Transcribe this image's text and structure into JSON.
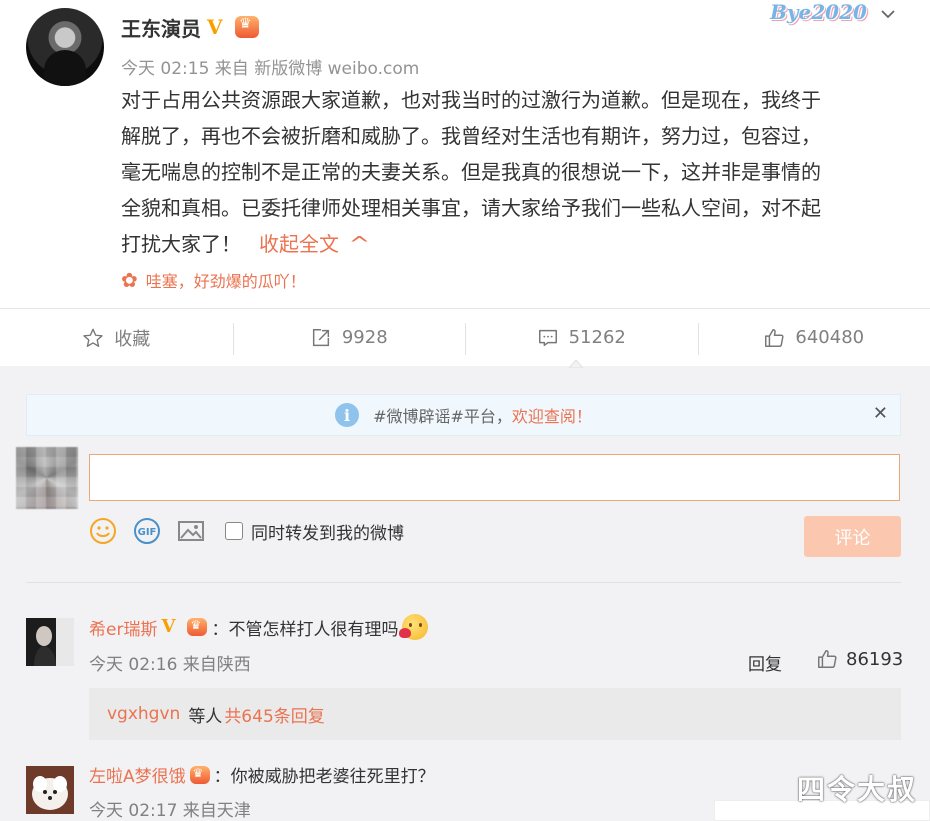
{
  "post": {
    "author": "王东演员",
    "verified_mark": "V",
    "meta": "今天 02:15 来自 新版微博 weibo.com",
    "text_lines": [
      "对于占用公共资源跟大家道歉，也对我当时的过激行为道歉。但是现在，我终于",
      "解脱了，再也不会被折磨和威胁了。我曾经对生活也有期许，努力过，包容过，",
      "毫无喘息的控制不是正常的夫妻关系。但是我真的很想说一下，这并非是事情的",
      "全貌和真相。已委托律师处理相关事宜，请大家给予我们一些私人空间，对不起"
    ],
    "last_line": "打扰大家了！",
    "collapse_label": "收起全文",
    "topic": "哇塞，好劲爆的瓜吖！",
    "logo_text": "Bye2020"
  },
  "actions": {
    "favorite": "收藏",
    "repost_count": "9928",
    "comment_count": "51262",
    "like_count": "640480"
  },
  "notice": {
    "topic": "#微博辟谣#平台，",
    "highlight": "欢迎查阅！"
  },
  "composer": {
    "placeholder": "",
    "repost_label": "同时转发到我的微博",
    "submit_label": "评论"
  },
  "comments": [
    {
      "user": "希er瑞斯",
      "verified_mark": "V",
      "text": "：不管怎样打人很有理吗",
      "meta": "今天 02:16 来自陕西",
      "reply_label": "回复",
      "likes": "86193",
      "replies_user": "vgxhgvn",
      "replies_mid": "等人",
      "replies_count": "共645条回复"
    },
    {
      "user": "左啦A梦很饿",
      "text": "：你被威胁把老婆往死里打？",
      "meta": "今天 02:17 来自天津"
    }
  ],
  "watermark": "四令大叔",
  "colors": {
    "accent": "#eb7350",
    "verified": "#f7a000",
    "submit_disabled": "#fbc7ae"
  }
}
